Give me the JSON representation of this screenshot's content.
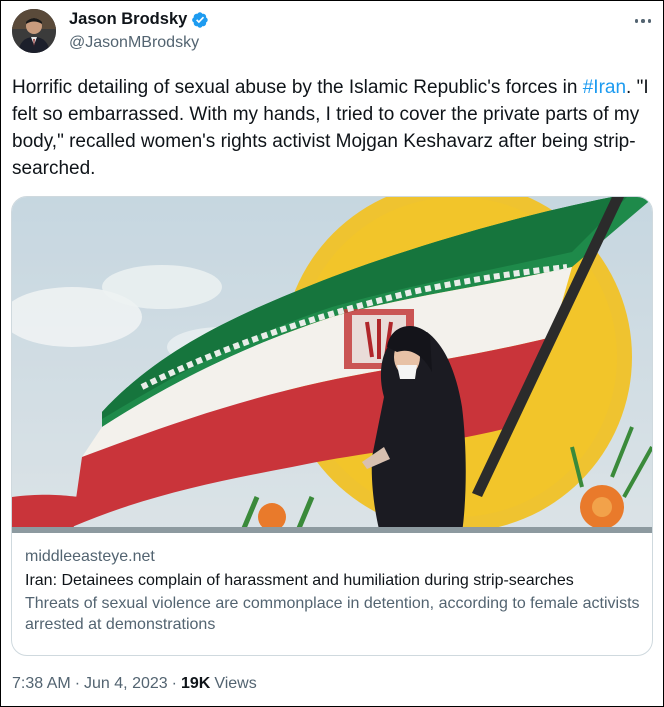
{
  "author": {
    "name": "Jason Brodsky",
    "handle": "@JasonMBrodsky",
    "verified": true,
    "avatar_icon": "user-avatar"
  },
  "tweet": {
    "text_before": "Horrific detailing of sexual abuse by the Islamic Republic's forces in ",
    "hashtag": "#Iran",
    "text_after": ". \"I felt so embarrassed. With my hands, I tried to cover the private parts of my body,\" recalled women's rights activist Mojgan Keshavarz after being strip-searched."
  },
  "link_card": {
    "image_icon": "mural-flag-photo",
    "domain": "middleeasteye.net",
    "title": "Iran: Detainees complain of harassment and humiliation during strip-searches",
    "description": "Threats of sexual violence are commonplace in detention, according to female activists arrested at demonstrations"
  },
  "meta": {
    "time": "7:38 AM",
    "separator": "·",
    "date": "Jun 4, 2023",
    "views_count": "19K",
    "views_label": "Views"
  },
  "colors": {
    "link": "#1d9bf0",
    "secondary_text": "#536471",
    "primary_text": "#0f1419",
    "verified_badge": "#1d9bf0",
    "card_border": "#cfd9de"
  }
}
